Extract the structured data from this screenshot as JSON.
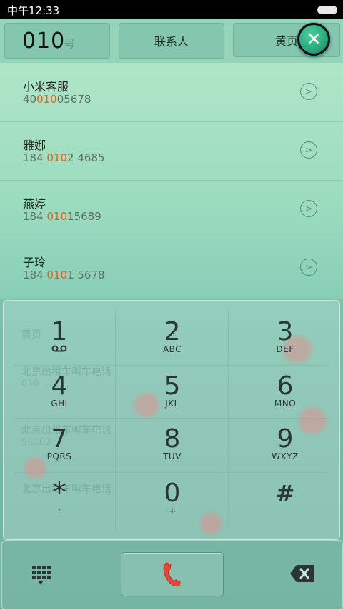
{
  "status_bar": {
    "time": "中午12:33"
  },
  "tabs": {
    "call_log_input": "010",
    "call_log_ghost": "号",
    "contacts": "联系人",
    "yellow_pages": "黄页"
  },
  "close_label": "✕",
  "results": [
    {
      "name": "小米客服",
      "pre": "40",
      "match": "010",
      "post": "05678"
    },
    {
      "name": "雅娜",
      "pre": "184 ",
      "match": "010",
      "post": "2 4685"
    },
    {
      "name": "燕婷",
      "pre": "184 ",
      "match": "010",
      "post": "15689"
    },
    {
      "name": "子玲",
      "pre": "184 ",
      "match": "010",
      "post": "1 5678"
    }
  ],
  "background_list": {
    "header": "黄页",
    "rows": [
      "北京出租车叫车电话",
      "北京出租车叫车电话",
      "北京出租车叫车电话"
    ],
    "subs": [
      "010-...",
      "96103"
    ]
  },
  "keypad": {
    "keys": [
      {
        "digit": "1",
        "letters": ""
      },
      {
        "digit": "2",
        "letters": "ABC"
      },
      {
        "digit": "3",
        "letters": "DEF"
      },
      {
        "digit": "4",
        "letters": "GHI"
      },
      {
        "digit": "5",
        "letters": "JKL"
      },
      {
        "digit": "6",
        "letters": "MNO"
      },
      {
        "digit": "7",
        "letters": "PQRS"
      },
      {
        "digit": "8",
        "letters": "TUV"
      },
      {
        "digit": "9",
        "letters": "WXYZ"
      },
      {
        "digit": "*",
        "letters": ","
      },
      {
        "digit": "0",
        "letters": "+"
      },
      {
        "digit": "#",
        "letters": ""
      }
    ]
  },
  "icons": {
    "voicemail": "voicemail-icon",
    "dialpad": "dialpad-toggle-icon",
    "call": "phone-handset-icon",
    "delete": "backspace-icon"
  },
  "colors": {
    "highlight": "#e0601c",
    "call_icon": "#e8453c",
    "status_bar": "#000000"
  }
}
